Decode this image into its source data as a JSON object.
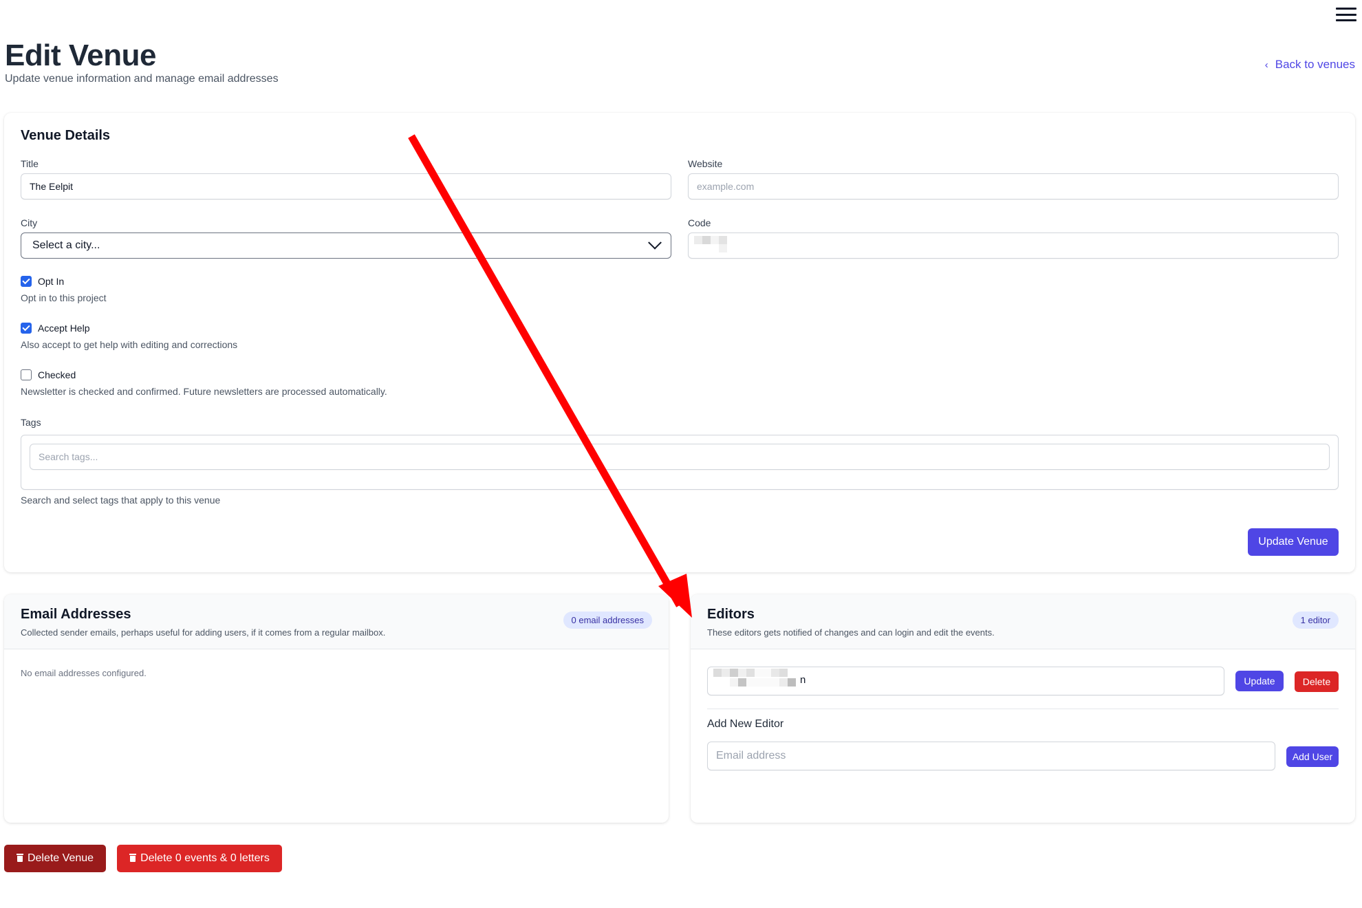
{
  "header": {
    "title": "Edit Venue",
    "subtitle": "Update venue information and manage email addresses",
    "back_link": "Back to venues"
  },
  "venue_details": {
    "section_title": "Venue Details",
    "title_label": "Title",
    "title_value": "The Eelpit",
    "website_label": "Website",
    "website_placeholder": "example.com",
    "city_label": "City",
    "city_selected": "Select a city...",
    "code_label": "Code",
    "opt_in": {
      "label": "Opt In",
      "help": "Opt in to this project",
      "checked": true
    },
    "accept_help": {
      "label": "Accept Help",
      "help": "Also accept to get help with editing and corrections",
      "checked": true
    },
    "checked": {
      "label": "Checked",
      "help": "Newsletter is checked and confirmed. Future newsletters are processed automatically.",
      "checked": false
    },
    "tags_label": "Tags",
    "tags_placeholder": "Search tags...",
    "tags_help": "Search and select tags that apply to this venue",
    "update_button": "Update Venue"
  },
  "email_addresses": {
    "title": "Email Addresses",
    "subtitle": "Collected sender emails, perhaps useful for adding users, if it comes from a regular mailbox.",
    "badge": "0 email addresses",
    "empty": "No email addresses configured."
  },
  "editors": {
    "title": "Editors",
    "subtitle": "These editors gets notified of changes and can login and edit the events.",
    "badge": "1 editor",
    "editor_value_tail": "n",
    "update_button": "Update",
    "delete_button": "Delete",
    "add_title": "Add New Editor",
    "add_placeholder": "Email address",
    "add_button": "Add User"
  },
  "footer": {
    "delete_venue": "Delete Venue",
    "delete_events": "Delete 0 events & 0 letters"
  },
  "colors": {
    "primary": "#4f46e5",
    "danger": "#dc2626",
    "danger_dark": "#991b1b",
    "checkbox": "#2563eb",
    "annotation_arrow": "#ff0000"
  }
}
